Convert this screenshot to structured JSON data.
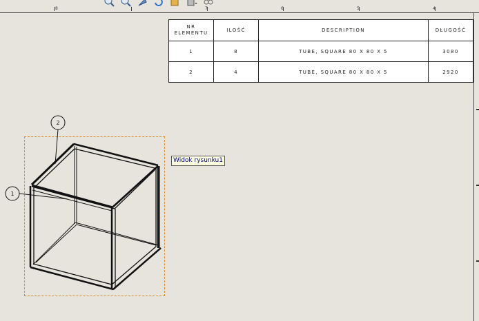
{
  "toolbar": {
    "icons": [
      "zoom-to-fit-icon",
      "zoom-in-icon",
      "pan-icon",
      "rotate-icon",
      "view-orientation-icon",
      "display-style-icon",
      "hide-show-icon"
    ]
  },
  "ruler": {
    "labels": [
      "8",
      "7",
      "6",
      "5",
      "4"
    ]
  },
  "bom": {
    "headers": {
      "item_no": "NR ELEMENTU",
      "qty": "ILOŚĆ",
      "description": "DESCRIPTION",
      "length": "DŁUGOŚĆ"
    },
    "rows": [
      {
        "item_no": "1",
        "qty": "8",
        "description": "TUBE, SQUARE 80 X 80 X 5",
        "length": "3080"
      },
      {
        "item_no": "2",
        "qty": "4",
        "description": "TUBE, SQUARE 80 X 80 X 5",
        "length": "2920"
      }
    ]
  },
  "view": {
    "tooltip": "Widok rysunku1",
    "balloons": [
      "1",
      "2"
    ]
  },
  "colors": {
    "background": "#e6e4dc",
    "selection_border": "#e08a2c",
    "tooltip_bg": "#ffffe1",
    "tooltip_text": "#00007a"
  }
}
